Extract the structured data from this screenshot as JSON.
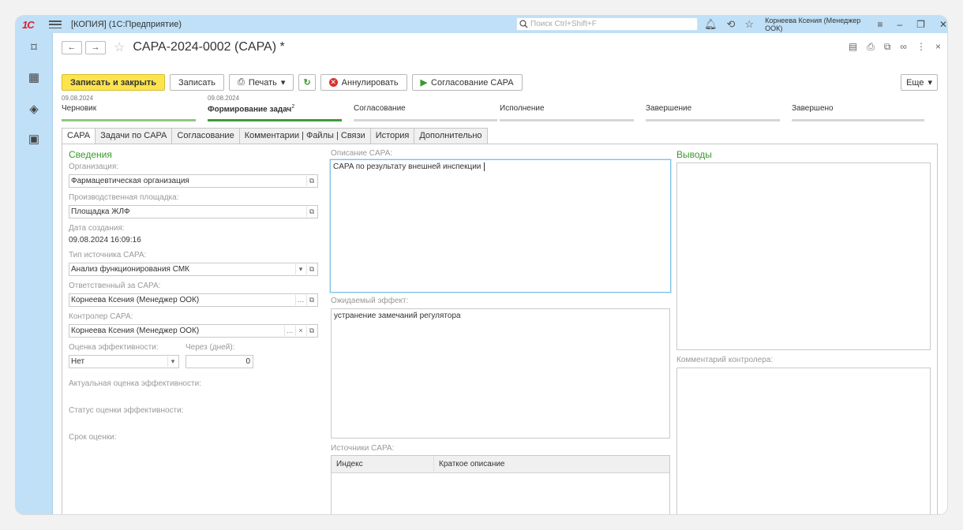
{
  "app": {
    "logo": "1С",
    "window_title": "[КОПИЯ]  (1С:Предприятие)"
  },
  "search": {
    "placeholder": "Поиск Ctrl+Shift+F"
  },
  "user": {
    "name": "Корнеева Ксения (Менеджер ООК)"
  },
  "document": {
    "title": "CAPA-2024-0002 (CAPA) *",
    "nav_back": "←",
    "nav_forward": "→"
  },
  "toolbar": {
    "save_close": "Записать и закрыть",
    "save": "Записать",
    "print": "Печать",
    "annul": "Аннулировать",
    "approve": "Согласование CAPA",
    "more": "Еще"
  },
  "stages": [
    {
      "date": "09.08.2024",
      "name": "Черновик",
      "state": "done"
    },
    {
      "date": "09.08.2024",
      "name": "Формирование задач",
      "sup": "2",
      "state": "active"
    },
    {
      "date": "",
      "name": "Согласование",
      "state": "pending"
    },
    {
      "date": "",
      "name": "Исполнение",
      "state": "pending"
    },
    {
      "date": "",
      "name": "Завершение",
      "state": "pending"
    },
    {
      "date": "",
      "name": "Завершено",
      "state": "pending"
    }
  ],
  "tabs": [
    "CAPA",
    "Задачи по CAPA",
    "Согласование",
    "Комментарии | Файлы | Связи",
    "История",
    "Дополнительно"
  ],
  "details": {
    "section_title": "Сведения",
    "org_label": "Организация:",
    "org_value": "Фармацевтическая организация",
    "site_label": "Производственная площадка:",
    "site_value": "Площадка ЖЛФ",
    "created_label": "Дата создания:",
    "created_value": "09.08.2024 16:09:16",
    "source_type_label": "Тип источника CAPA:",
    "source_type_value": "Анализ функционирования СМК",
    "responsible_label": "Ответственный за CAPA:",
    "responsible_value": "Корнеева Ксения (Менеджер ООК)",
    "controller_label": "Контролер CAPA:",
    "controller_value": "Корнеева Ксения (Менеджер ООК)",
    "eff_label": "Оценка эффективности:",
    "eff_value": "Нет",
    "days_label": "Через (дней):",
    "days_value": "0",
    "actual_eff_label": "Актуальная оценка эффективности:",
    "eff_status_label": "Статус оценки эффективности:",
    "eff_deadline_label": "Срок оценки:"
  },
  "description": {
    "label": "Описание CAPA:",
    "value": "CAPA по результату внешней инспекции",
    "expected_label": "Ожидаемый эффект:",
    "expected_value": "устранение замечаний регулятора",
    "sources_label": "Источники CAPA:",
    "sources_columns": [
      "Индекс",
      "Краткое описание"
    ]
  },
  "conclusions": {
    "title": "Выводы",
    "controller_comment_label": "Комментарий контролера:"
  }
}
